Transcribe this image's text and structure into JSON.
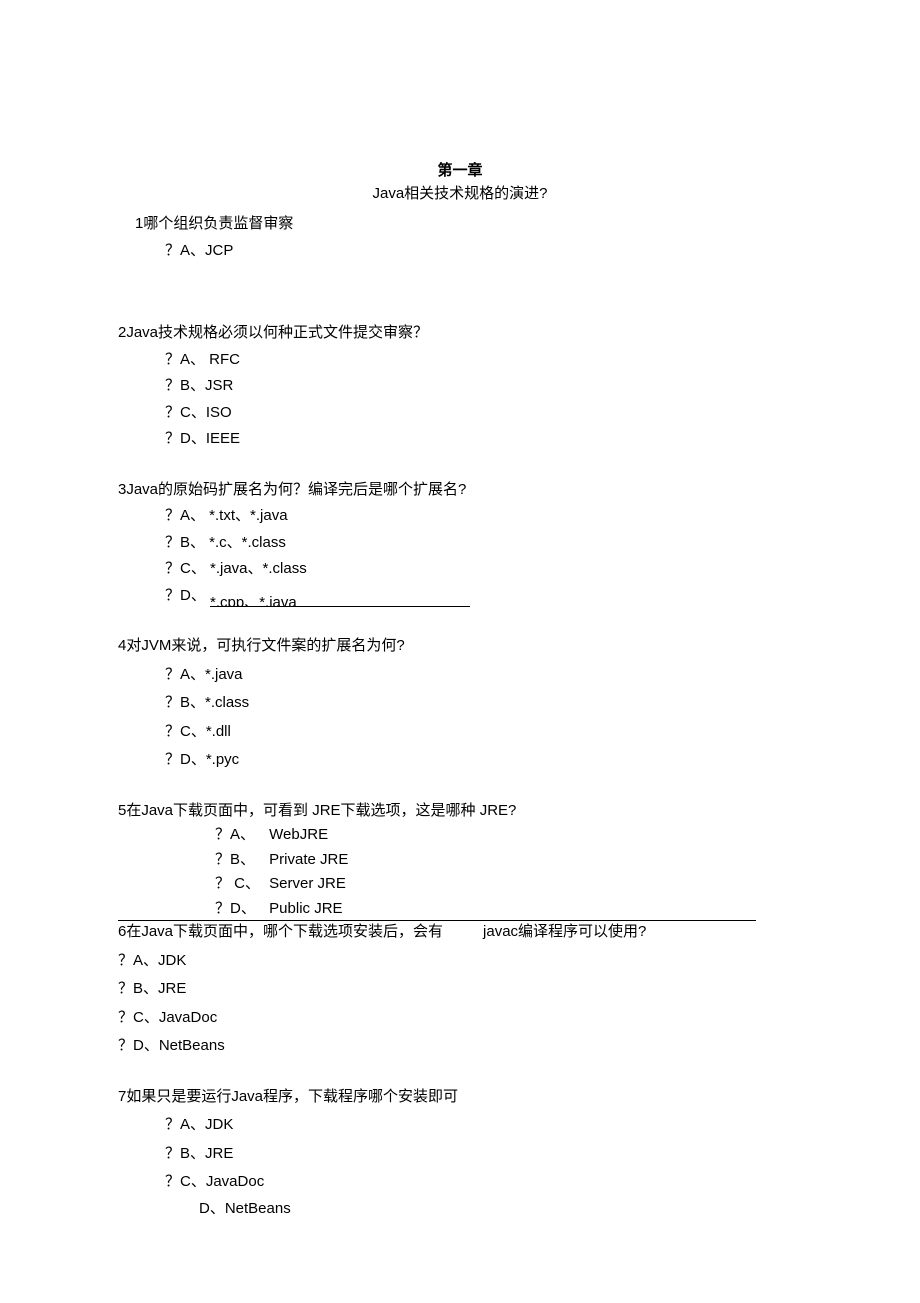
{
  "chapter_title": "第一章",
  "subtitle": "Java相关技术规格的演进?",
  "q1": {
    "text": "1哪个组织负责监督审察",
    "a": "？A、JCP"
  },
  "q2": {
    "text": "2Java技术规格必须以何种正式文件提交审察？",
    "a": "？A、  RFC",
    "b": "？B、JSR",
    "c": "？C、ISO",
    "d": "？D、IEEE"
  },
  "q3": {
    "text": "3Java的原始码扩展名为何？编译完后是哪个扩展名?",
    "a": "？A、   *.txt、*.java",
    "b": "？B、  *.c、*.class",
    "c": "？C、  *.java、*.class",
    "d_prefix": "？D、",
    "d_val": "*.cpp、*.java"
  },
  "q4": {
    "text": "4对JVM来说，可执行文件案的扩展名为何?",
    "a": "？A、*.java",
    "b": "？B、*.class",
    "c": "？C、*.dll",
    "d": "？D、*.pyc"
  },
  "q5": {
    "text": "5在Java下载页面中，可看到 JRE下载选项，这是哪种 JRE?",
    "a_label": "？A、",
    "a_val": "WebJRE",
    "b_label": "？B、",
    "b_val": "Private JRE",
    "c_label": "？ C、",
    "c_val": "Server JRE",
    "d_label": "？D、",
    "d_val": "Public JRE"
  },
  "q6": {
    "text_p1": "6在Java下载页面中，哪个下载选项安装后，会有",
    "text_p2": "javac编译程序可以使用?",
    "a": "？A、JDK",
    "b": "？B、JRE",
    "c": "？C、JavaDoc",
    "d": "？D、NetBeans"
  },
  "q7": {
    "text": "7如果只是要运行Java程序，下载程序哪个安装即可",
    "a": "？A、JDK",
    "b": "？B、JRE",
    "c": "？C、JavaDoc",
    "d": "D、NetBeans"
  }
}
